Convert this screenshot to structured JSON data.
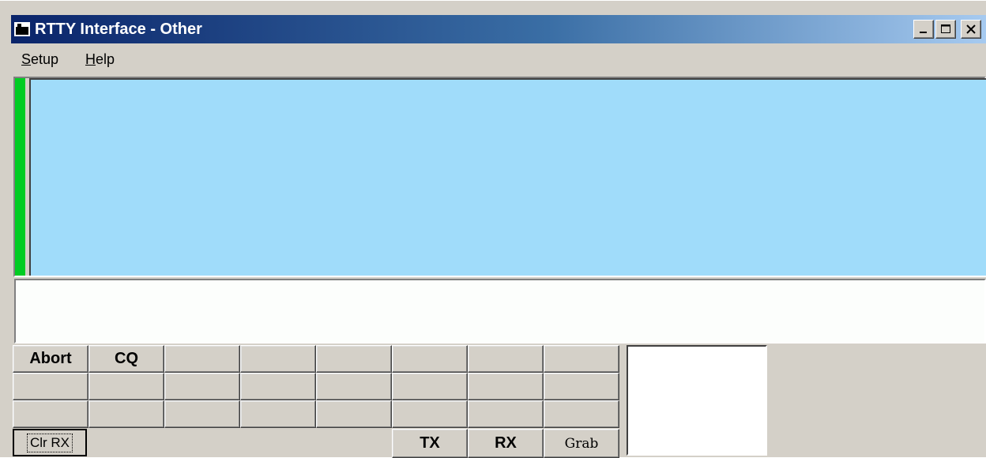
{
  "window": {
    "title": "RTTY Interface - Other",
    "title_icon": "app-icon",
    "controls": [
      "minimize-icon",
      "maximize-icon",
      "close-icon"
    ],
    "titlebar_color": "#0a246a"
  },
  "menu": {
    "setup": {
      "accel": "S",
      "rest": "etup"
    },
    "help": {
      "accel": "H",
      "rest": "elp"
    }
  },
  "receive_pane": {
    "background": "#a0dcfa",
    "tuning_bar_color": "#00cc22"
  },
  "transmit_pane": {
    "value": ""
  },
  "buttons": {
    "abort": "Abort",
    "cq": "CQ",
    "clr_rx": "Clr RX",
    "tx": "TX",
    "rx": "RX",
    "grab": "Grab"
  }
}
